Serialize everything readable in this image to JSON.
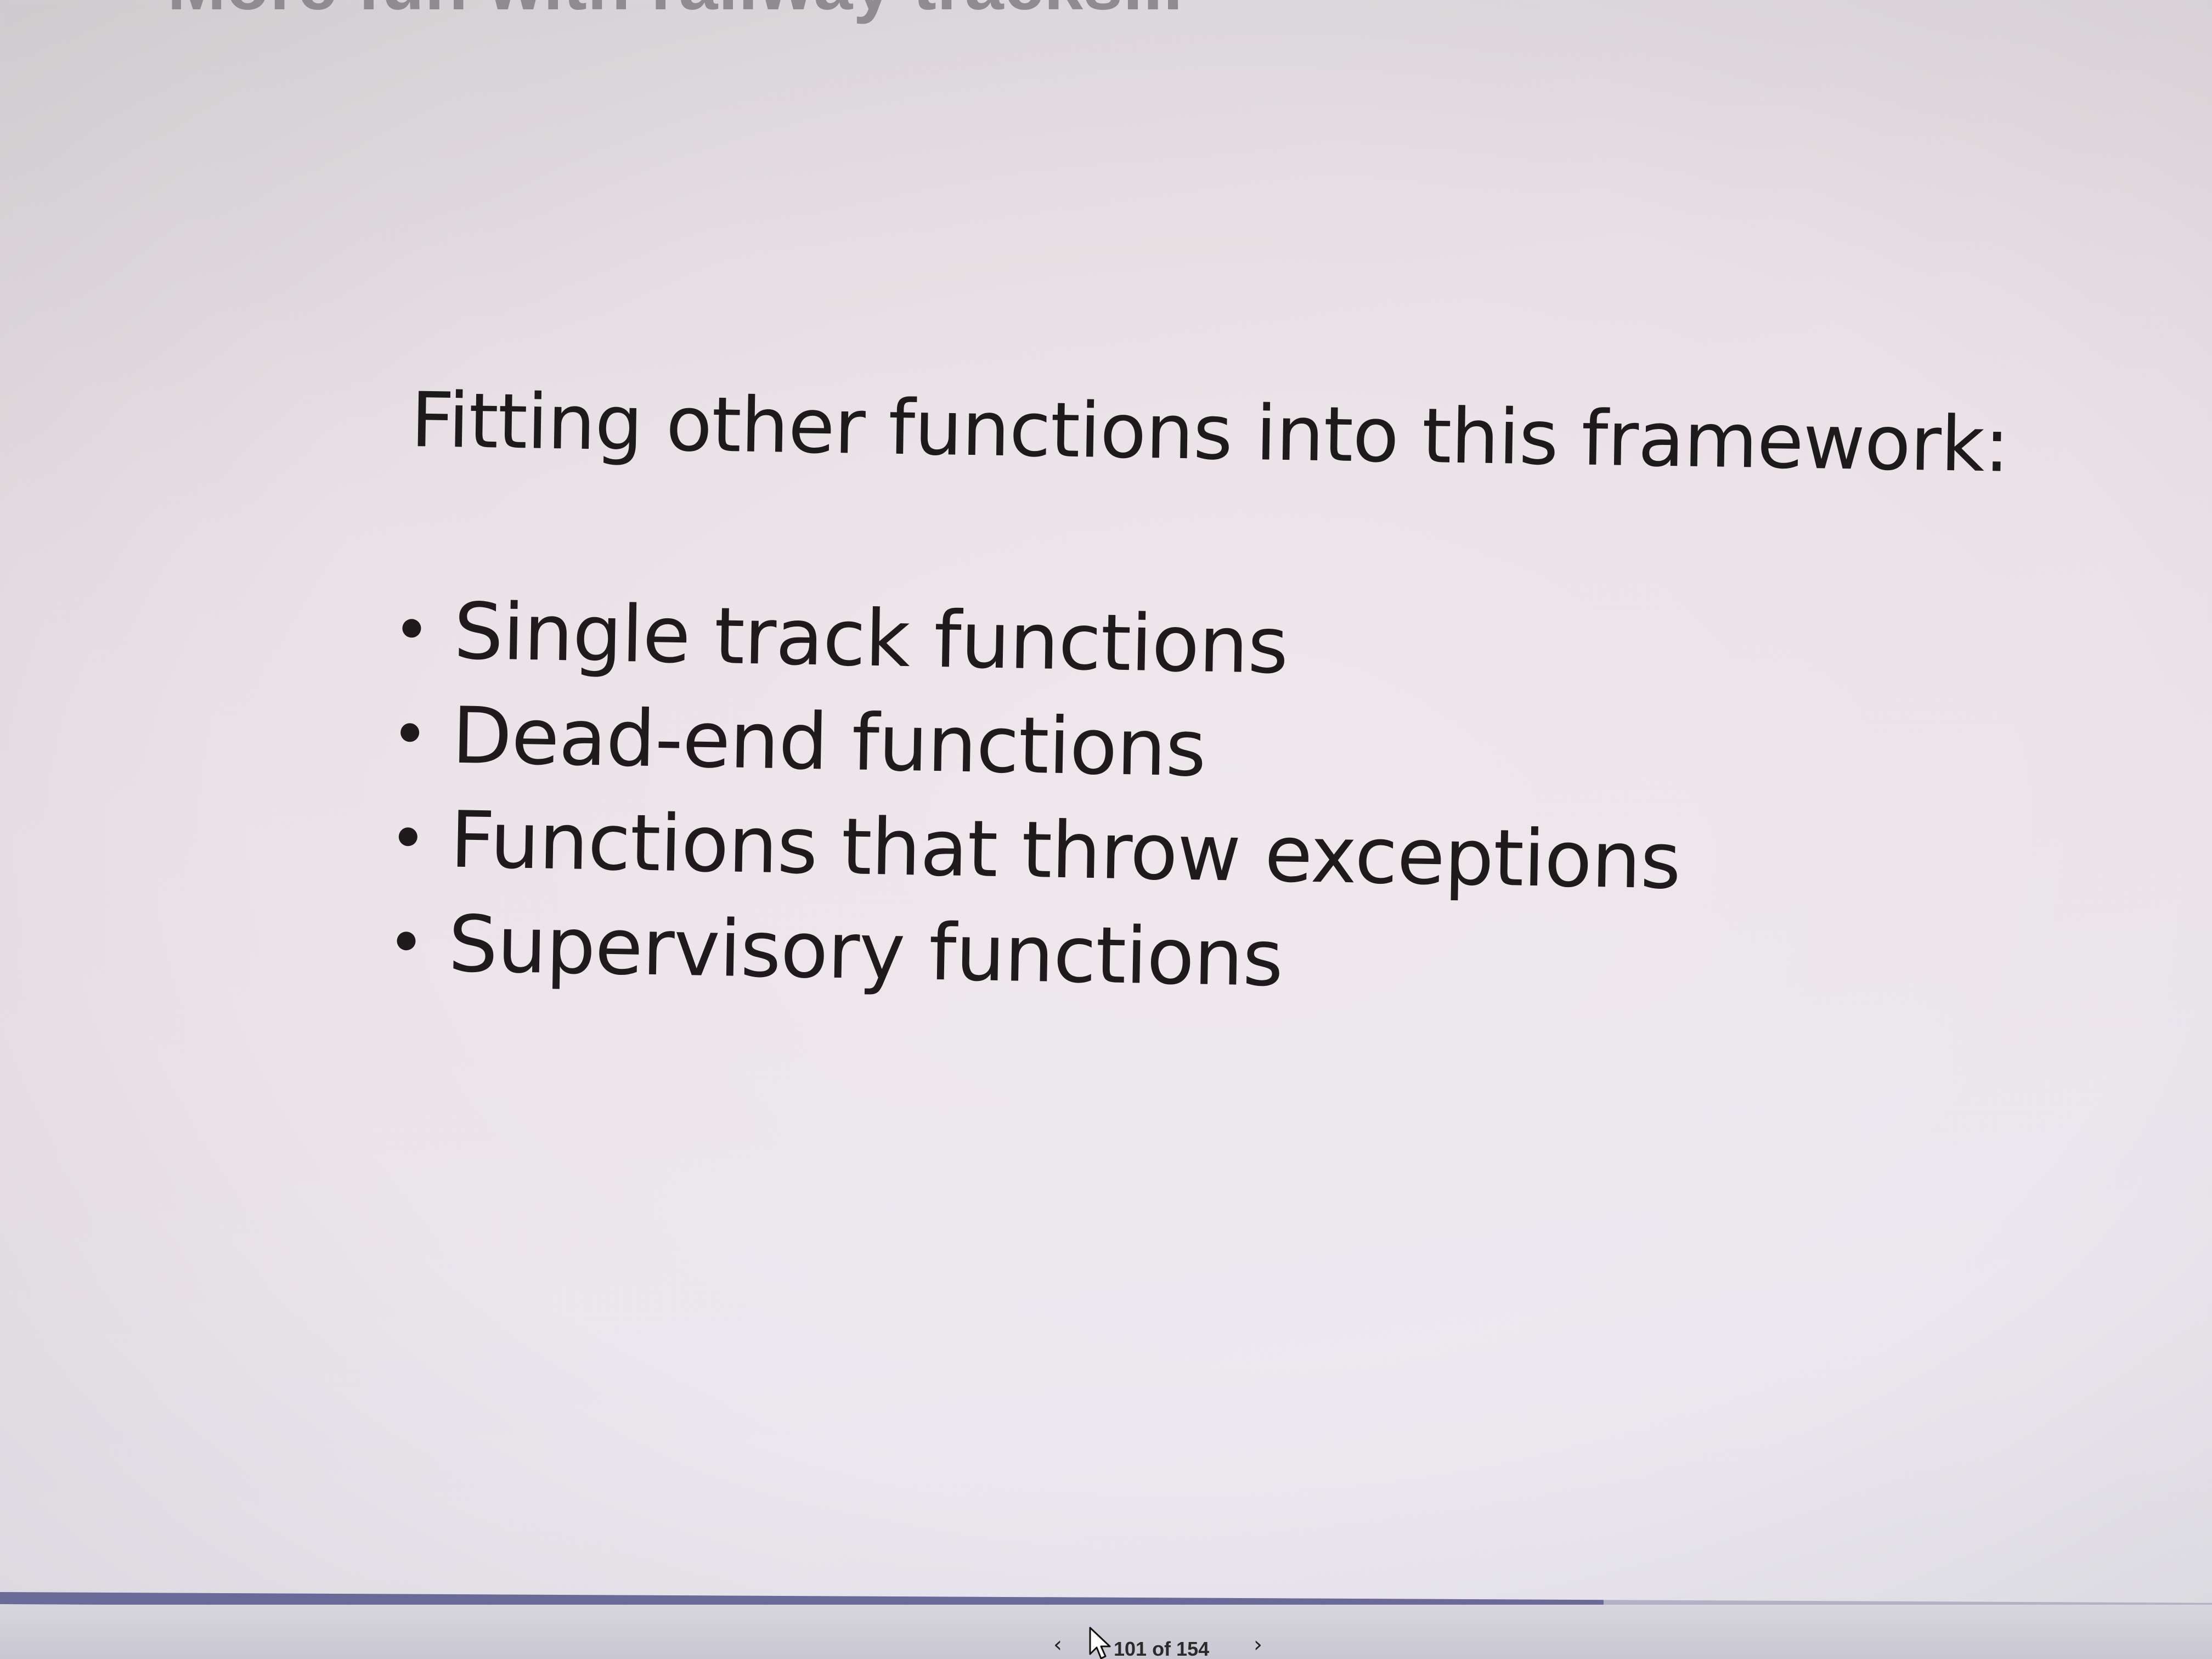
{
  "slide": {
    "title": "More fun with railway tracks...",
    "heading": "Fitting other functions into this framework:",
    "bullets": [
      "Single track functions",
      "Dead-end functions",
      "Functions that throw exceptions",
      "Supervisory functions"
    ]
  },
  "navigation": {
    "prev_icon": "chevron-left-icon",
    "prev_glyph": "‹",
    "next_icon": "chevron-right-icon",
    "next_glyph": "›",
    "page_counter": "101 of 154",
    "progress_fraction": 0.725
  },
  "colors": {
    "progress_fill": "#6a6a98",
    "progress_track": "#b3b2c4",
    "title_text": "#8f8c91",
    "body_text": "#1f1a1b"
  }
}
